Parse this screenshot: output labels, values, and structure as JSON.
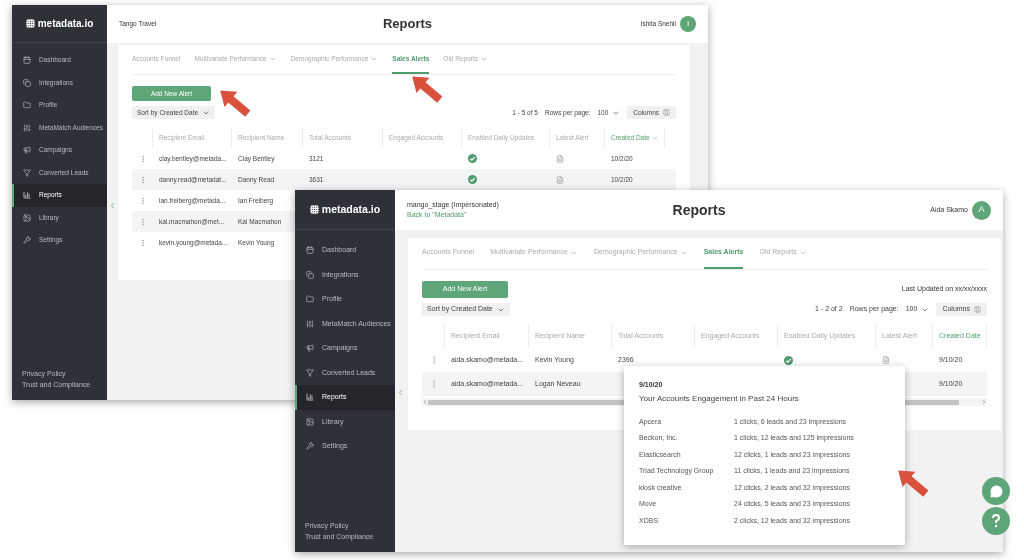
{
  "windows": [
    {
      "kind": "back",
      "brand": "metadata.io",
      "header": {
        "account": "Tango Travel",
        "title": "Reports",
        "user": "Ishita Snehil",
        "initial": "I"
      },
      "sidebar": {
        "items": [
          {
            "label": "Dashboard",
            "selected": false
          },
          {
            "label": "Integrations",
            "selected": false
          },
          {
            "label": "Profile",
            "selected": false
          },
          {
            "label": "MetaMatch Audiences",
            "selected": false
          },
          {
            "label": "Campaigns",
            "selected": false
          },
          {
            "label": "Converted Leads",
            "selected": false
          },
          {
            "label": "Reports",
            "selected": true
          },
          {
            "label": "Library",
            "selected": false
          },
          {
            "label": "Settings",
            "selected": false
          }
        ],
        "footer_links": [
          "Privacy Policy",
          "Trust and Compliance"
        ]
      },
      "tabs": [
        {
          "label": "Accounts Funnel",
          "dropdown": false,
          "selected": false
        },
        {
          "label": "Multivariate Performance",
          "dropdown": true,
          "selected": false
        },
        {
          "label": "Demographic Performance",
          "dropdown": true,
          "selected": false
        },
        {
          "label": "Sales Alerts",
          "dropdown": false,
          "selected": true
        },
        {
          "label": "Old Reports",
          "dropdown": true,
          "selected": false
        }
      ],
      "add_button": "Add New Alert",
      "sort": "Sort by Created Date",
      "pagination": {
        "range": "1 - 5 of 5",
        "rows_label": "Rows per page:",
        "rows_value": "100"
      },
      "columns_button": "Columns",
      "table": {
        "columns": [
          {
            "label": "Recipient Email",
            "sorted": false
          },
          {
            "label": "Recipient Name",
            "sorted": false
          },
          {
            "label": "Total Accounts",
            "sorted": false
          },
          {
            "label": "Engaged Accounts",
            "sorted": false
          },
          {
            "label": "Enabled Daily Updates",
            "sorted": false
          },
          {
            "label": "Latest Alert",
            "sorted": false
          },
          {
            "label": "Created Date",
            "sorted": true
          }
        ],
        "rows": [
          {
            "email": "clay.bentley@metada...",
            "name": "Clay Bentley",
            "total": "3121",
            "updates_enabled": true,
            "latest_alert": true,
            "created": "10/2/20"
          },
          {
            "email": "danny.read@metadat...",
            "name": "Danny Read",
            "total": "3631",
            "updates_enabled": true,
            "latest_alert": true,
            "created": "10/2/20"
          },
          {
            "email": "ian.freiberg@metada...",
            "name": "Ian Freiberg"
          },
          {
            "email": "kai.macmahon@met...",
            "name": "Kai Macmahon"
          },
          {
            "email": "kevin.young@metada...",
            "name": "Kevin Young"
          }
        ]
      }
    },
    {
      "kind": "front",
      "brand": "metadata.io",
      "header": {
        "account": "mango_stage (Impersonated)",
        "back_link": "Back to \"Metadata\"",
        "title": "Reports",
        "user": "Aida Skamo",
        "initial": "A"
      },
      "sidebar": {
        "items": [
          {
            "label": "Dashboard",
            "selected": false
          },
          {
            "label": "Integrations",
            "selected": false
          },
          {
            "label": "Profile",
            "selected": false
          },
          {
            "label": "MetaMatch Audiences",
            "selected": false
          },
          {
            "label": "Campaigns",
            "selected": false
          },
          {
            "label": "Converted Leads",
            "selected": false
          },
          {
            "label": "Reports",
            "selected": true
          },
          {
            "label": "Library",
            "selected": false
          },
          {
            "label": "Settings",
            "selected": false
          }
        ],
        "footer_links": [
          "Privacy Policy",
          "Trust and Compliance"
        ]
      },
      "tabs": [
        {
          "label": "Accounts Funnel",
          "dropdown": false,
          "selected": false
        },
        {
          "label": "Multivariate Performance",
          "dropdown": true,
          "selected": false
        },
        {
          "label": "Demographic Performance",
          "dropdown": true,
          "selected": false
        },
        {
          "label": "Sales Alerts",
          "dropdown": false,
          "selected": true
        },
        {
          "label": "Old Reports",
          "dropdown": true,
          "selected": false
        }
      ],
      "add_button": "Add New Alert",
      "last_updated": "Last Updated on xx/xx/xxxx",
      "sort": "Sort by Created Date",
      "pagination": {
        "range": "1 - 2 of 2",
        "rows_label": "Rows per page:",
        "rows_value": "100"
      },
      "columns_button": "Columns",
      "table": {
        "columns": [
          {
            "label": "Recipient Email",
            "sorted": false
          },
          {
            "label": "Recipient Name",
            "sorted": false
          },
          {
            "label": "Total Accounts",
            "sorted": false
          },
          {
            "label": "Engaged Accounts",
            "sorted": false
          },
          {
            "label": "Enabled Daily Updates",
            "sorted": false
          },
          {
            "label": "Latest Alert",
            "sorted": false
          },
          {
            "label": "Created Date",
            "sorted": true
          }
        ],
        "rows": [
          {
            "email": "aida.skamo@metada...",
            "name": "Kevin Young",
            "total": "2396",
            "updates_enabled": true,
            "latest_alert": true,
            "created": "9/10/20"
          },
          {
            "email": "aida.skamo@metada...",
            "name": "Logan Neveau",
            "created": "9/10/20"
          }
        ]
      }
    }
  ],
  "popover": {
    "date": "9/10/20",
    "title": "Your Accounts Engagement in Past 24 Hours",
    "rows": [
      {
        "account": "Apcera",
        "summary": "1 clicks, 6 leads and 23 impressions"
      },
      {
        "account": "Beckon, Inc.",
        "summary": "1 clicks, 12 leads and 125 impressions"
      },
      {
        "account": "Elasticsearch",
        "summary": "12 clicks, 1 leads and 23 impressions"
      },
      {
        "account": "Triad Technology Group",
        "summary": "11 clicks, 1 leads and 23 impressions"
      },
      {
        "account": "kiosk creative",
        "summary": "12 clicks, 2 leads and 32 impressions"
      },
      {
        "account": "Move",
        "summary": "24 clicks, 5 leads and 23 impressions"
      },
      {
        "account": "XDBS",
        "summary": "2 clicks, 12 leads and 32 impressions"
      }
    ]
  }
}
